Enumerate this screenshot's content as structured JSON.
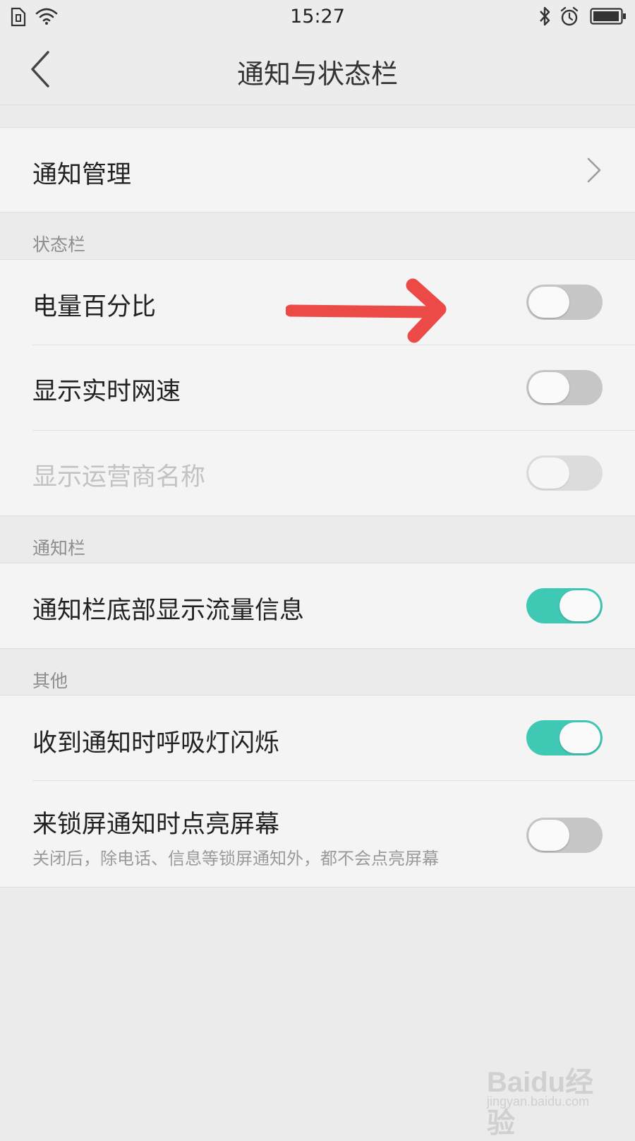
{
  "status_bar": {
    "time": "15:27",
    "left_icons": [
      "sim-card-icon",
      "wifi-icon"
    ],
    "right_icons": [
      "bluetooth-icon",
      "alarm-icon",
      "battery-icon"
    ]
  },
  "header": {
    "title": "通知与状态栏",
    "back_icon": "back-arrow-icon"
  },
  "notification_management": {
    "label": "通知管理",
    "icon": "chevron-right-icon"
  },
  "sections": {
    "status_bar": {
      "title": "状态栏",
      "items": [
        {
          "label": "电量百分比",
          "on": false,
          "enabled": true
        },
        {
          "label": "显示实时网速",
          "on": false,
          "enabled": true
        },
        {
          "label": "显示运营商名称",
          "on": false,
          "enabled": false
        }
      ]
    },
    "notification_bar": {
      "title": "通知栏",
      "items": [
        {
          "label": "通知栏底部显示流量信息",
          "on": true,
          "enabled": true
        }
      ]
    },
    "other": {
      "title": "其他",
      "items": [
        {
          "label": "收到通知时呼吸灯闪烁",
          "on": true,
          "enabled": true
        },
        {
          "label": "来锁屏通知时点亮屏幕",
          "description": "关闭后，除电话、信息等锁屏通知外，都不会点亮屏幕",
          "on": false,
          "enabled": true
        }
      ]
    }
  },
  "annotation": {
    "icon": "red-arrow-icon",
    "color": "#ec4a47"
  },
  "colors": {
    "toggle_on": "#3fc9b5",
    "toggle_off": "#c6c6c6",
    "background": "#ebebeb"
  },
  "watermark": {
    "brand": "Baidu经验",
    "url": "jingyan.baidu.com"
  }
}
